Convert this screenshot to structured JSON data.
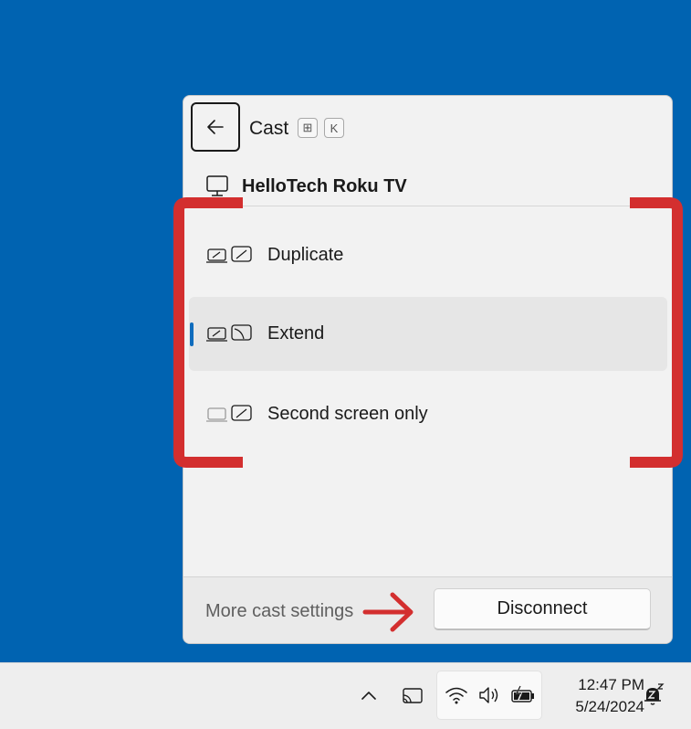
{
  "cast_panel": {
    "title": "Cast",
    "shortcut_keys": [
      "⊞",
      "K"
    ],
    "device_name": "HelloTech Roku TV",
    "modes": [
      {
        "label": "Duplicate",
        "icon": "duplicate-display-icon",
        "selected": false
      },
      {
        "label": "Extend",
        "icon": "extend-display-icon",
        "selected": true
      },
      {
        "label": "Second screen only",
        "icon": "second-screen-only-icon",
        "selected": false
      }
    ],
    "footer": {
      "more_settings_label": "More cast settings",
      "disconnect_label": "Disconnect"
    }
  },
  "taskbar": {
    "icons": [
      "chevron-up-icon",
      "cast-icon",
      "wifi-icon",
      "volume-icon",
      "battery-charging-icon",
      "notifications-dnd-icon"
    ],
    "time": "12:47 PM",
    "date": "5/24/2024"
  },
  "colors": {
    "desktop": "#0063b1",
    "annotation_red": "#d32f2f",
    "accent": "#0f6cbd"
  }
}
